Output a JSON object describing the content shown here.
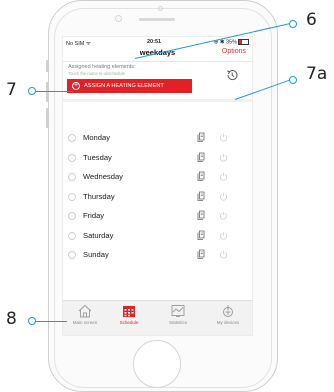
{
  "status_bar": {
    "carrier": "No SIM",
    "time": "20:51",
    "battery": "35%"
  },
  "nav": {
    "title": "weekdays",
    "options": "Options"
  },
  "assigned": {
    "title": "Assigned heating elements:",
    "subtitle": "Touch the name to unschedule",
    "assign_button": "ASSIGN A HEATING ELEMENT"
  },
  "days": [
    "Monday",
    "Tuesday",
    "Wednesday",
    "Thursday",
    "Friday",
    "Saturday",
    "Sunday"
  ],
  "tabs": [
    {
      "label": "Main screen",
      "icon": "house-icon"
    },
    {
      "label": "Schedule",
      "icon": "calendar-icon"
    },
    {
      "label": "Statistics",
      "icon": "chart-icon"
    },
    {
      "label": "My devices",
      "icon": "devices-icon"
    }
  ],
  "callouts": {
    "c6": "6",
    "c7": "7",
    "c7a": "7a",
    "c8": "8"
  },
  "colors": {
    "accent": "#e32026",
    "callout": "#1e9ad6"
  }
}
